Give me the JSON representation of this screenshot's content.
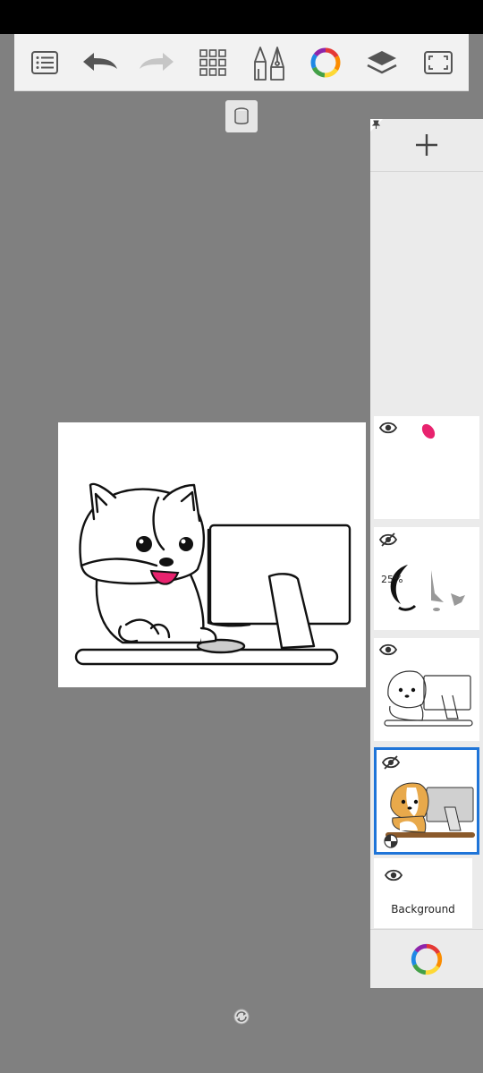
{
  "toolbar": {
    "buttons": [
      {
        "name": "menu-list",
        "enabled": true
      },
      {
        "name": "undo",
        "enabled": true
      },
      {
        "name": "redo",
        "enabled": false
      },
      {
        "name": "grid",
        "enabled": true
      },
      {
        "name": "brush-tools",
        "enabled": true
      },
      {
        "name": "color-wheel",
        "enabled": true
      },
      {
        "name": "layers",
        "enabled": true
      },
      {
        "name": "fullscreen",
        "enabled": true
      }
    ]
  },
  "layers": {
    "items": [
      {
        "visible": true,
        "opacity_label": "",
        "selected": false,
        "content": "pink-brush-mark"
      },
      {
        "visible": false,
        "opacity_label": "25%",
        "selected": false,
        "content": "ink-and-gray-strokes"
      },
      {
        "visible": true,
        "opacity_label": "",
        "selected": false,
        "content": "line-art"
      },
      {
        "visible": false,
        "opacity_label": "",
        "selected": true,
        "content": "colored-art"
      }
    ],
    "background_label": "Background"
  },
  "colors": {
    "accent_selected": "#1e74d8",
    "panel_bg": "#ebebeb",
    "workspace_bg": "#808080",
    "brush_pink": "#e8236e"
  }
}
